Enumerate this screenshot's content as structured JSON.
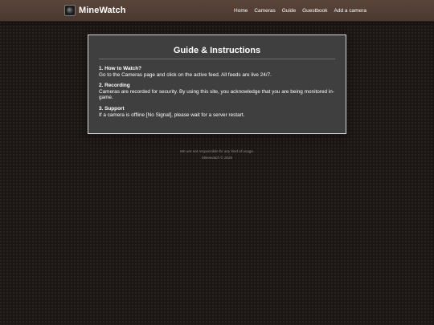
{
  "header": {
    "brand": "MineWatch",
    "logo_icon": "camera-lens-icon",
    "nav": [
      {
        "label": "Home"
      },
      {
        "label": "Cameras"
      },
      {
        "label": "Guide"
      },
      {
        "label": "Guestbook"
      },
      {
        "label": "Add a camera"
      }
    ]
  },
  "guide": {
    "title": "Guide & Instructions",
    "sections": [
      {
        "heading": "1. How to Watch?",
        "body": "Go to the Cameras page and click on the active feed. All feeds are live 24/7."
      },
      {
        "heading": "2. Recording",
        "body": "Cameras are recorded for security. By using this site, you acknowledge that you are being monitored in-game."
      },
      {
        "heading": "3. Support",
        "body": "If a camera is offline [No Signal], please wait for a server restart."
      }
    ]
  },
  "footer": {
    "disclaimer": "We are not responsible for any kind of usage.",
    "copyright": "Minewatch © 2026"
  },
  "colors": {
    "header_bg": "#5a4539",
    "page_bg": "#1b1614",
    "panel_bg": "#3f3f3f",
    "panel_border": "#d8d8d8"
  }
}
